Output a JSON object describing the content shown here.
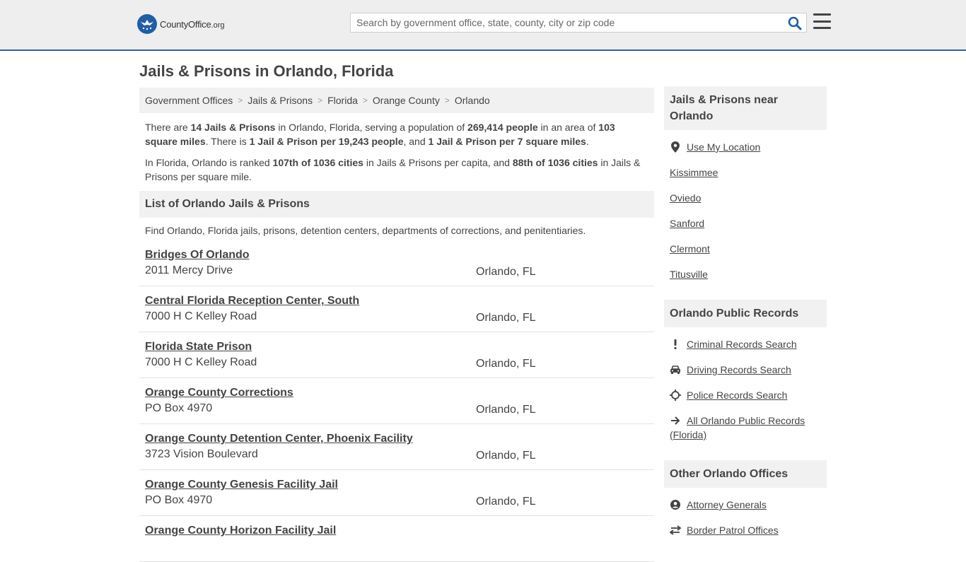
{
  "header": {
    "logo_name": "CountyOffice",
    "logo_tld": ".org",
    "search_placeholder": "Search by government office, state, county, city or zip code"
  },
  "page": {
    "title": "Jails & Prisons in Orlando, Florida"
  },
  "breadcrumb": [
    "Government Offices",
    "Jails & Prisons",
    "Florida",
    "Orange County",
    "Orlando"
  ],
  "intro": {
    "p1": {
      "t1": "There are ",
      "b1": "14 Jails & Prisons",
      "t2": " in Orlando, Florida, serving a population of ",
      "b2": "269,414 people",
      "t3": " in an area of ",
      "b3": "103 square miles",
      "t4": ". There is ",
      "b4": "1 Jail & Prison per 19,243 people",
      "t5": ", and ",
      "b5": "1 Jail & Prison per 7 square miles",
      "t6": "."
    },
    "p2": {
      "t1": "In Florida, Orlando is ranked ",
      "b1": "107th of 1036 cities",
      "t2": " in Jails & Prisons per capita, and ",
      "b2": "88th of 1036 cities",
      "t3": " in Jails & Prisons per square mile."
    }
  },
  "list": {
    "header": "List of Orlando Jails & Prisons",
    "description": "Find Orlando, Florida jails, prisons, detention centers, departments of corrections, and penitentiaries.",
    "items": [
      {
        "name": "Bridges Of Orlando",
        "address": "2011 Mercy Drive",
        "city": "Orlando, FL"
      },
      {
        "name": "Central Florida Reception Center, South",
        "address": "7000 H C Kelley Road",
        "city": "Orlando, FL"
      },
      {
        "name": "Florida State Prison",
        "address": "7000 H C Kelley Road",
        "city": "Orlando, FL"
      },
      {
        "name": "Orange County Corrections",
        "address": "PO Box 4970",
        "city": "Orlando, FL"
      },
      {
        "name": "Orange County Detention Center, Phoenix Facility",
        "address": "3723 Vision Boulevard",
        "city": "Orlando, FL"
      },
      {
        "name": "Orange County Genesis Facility Jail",
        "address": "PO Box 4970",
        "city": "Orlando, FL"
      },
      {
        "name": "Orange County Horizon Facility Jail",
        "address": "",
        "city": ""
      }
    ]
  },
  "sidebar": {
    "near": {
      "title": "Jails & Prisons near Orlando",
      "use_location": "Use My Location",
      "cities": [
        "Kissimmee",
        "Oviedo",
        "Sanford",
        "Clermont",
        "Titusville"
      ]
    },
    "records": {
      "title": "Orlando Public Records",
      "items": [
        {
          "icon": "exclamation-icon",
          "label": "Criminal Records Search"
        },
        {
          "icon": "car-icon",
          "label": "Driving Records Search"
        },
        {
          "icon": "crosshair-icon",
          "label": "Police Records Search"
        },
        {
          "icon": "arrow-right-icon",
          "label": "All Orlando Public Records (Florida)"
        }
      ]
    },
    "other": {
      "title": "Other Orlando Offices",
      "items": [
        {
          "icon": "user-icon",
          "label": "Attorney Generals"
        },
        {
          "icon": "arrows-icon",
          "label": "Border Patrol Offices"
        }
      ]
    }
  },
  "colors": {
    "brand_blue": "#1f5ea8",
    "header_bg": "#eeeeee",
    "panel_bg": "#f1f1f1",
    "search_icon": "#1f5ea8"
  }
}
